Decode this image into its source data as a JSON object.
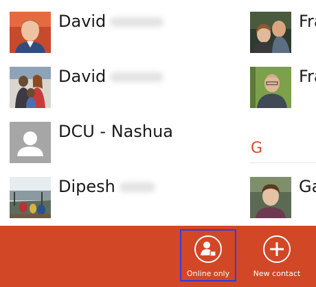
{
  "contacts_left": [
    {
      "first": "David",
      "hidden_last": "Gallant"
    },
    {
      "first": "David",
      "hidden_last": "Montes"
    },
    {
      "first": "DCU - Nashua",
      "hidden_last": ""
    },
    {
      "first": "Dipesh",
      "hidden_last": "Patel"
    }
  ],
  "contacts_right": [
    {
      "first": "Fra"
    },
    {
      "first": "Fra"
    },
    {
      "first": "Ga"
    }
  ],
  "group_letter": "G",
  "appbar": {
    "color": "#d24726",
    "online_only_label": "Online only",
    "new_contact_label": "New contact"
  },
  "colors": {
    "group_letter": "#d54b2a",
    "focus_outline": "#2f3ce6"
  }
}
